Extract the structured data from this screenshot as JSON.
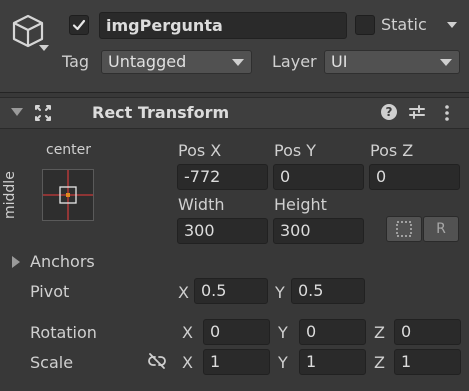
{
  "gameobject": {
    "active": true,
    "name": "imgPergunta",
    "static_label": "Static",
    "static_checked": false,
    "tag_label": "Tag",
    "tag_value": "Untagged",
    "layer_label": "Layer",
    "layer_value": "UI"
  },
  "component": {
    "title": "Rect Transform",
    "expanded": true
  },
  "anchor_preset": {
    "horizontal_label": "center",
    "vertical_label": "middle"
  },
  "rect": {
    "pos_x_label": "Pos X",
    "pos_y_label": "Pos Y",
    "pos_z_label": "Pos Z",
    "pos_x": "-772",
    "pos_y": "0",
    "pos_z": "0",
    "width_label": "Width",
    "height_label": "Height",
    "width": "300",
    "height": "300",
    "r_button": "R"
  },
  "anchors": {
    "label": "Anchors"
  },
  "pivot": {
    "label": "Pivot",
    "x_label": "X",
    "y_label": "Y",
    "x": "0.5",
    "y": "0.5"
  },
  "rotation": {
    "label": "Rotation",
    "x_label": "X",
    "y_label": "Y",
    "z_label": "Z",
    "x": "0",
    "y": "0",
    "z": "0"
  },
  "scale": {
    "label": "Scale",
    "x_label": "X",
    "y_label": "Y",
    "z_label": "Z",
    "x": "1",
    "y": "1",
    "z": "1"
  },
  "colors": {
    "background": "#383838",
    "header": "#3e3e3e",
    "field": "#2a2a2a",
    "accent_red": "#c83a3a",
    "accent_orange": "#e08a1e"
  }
}
